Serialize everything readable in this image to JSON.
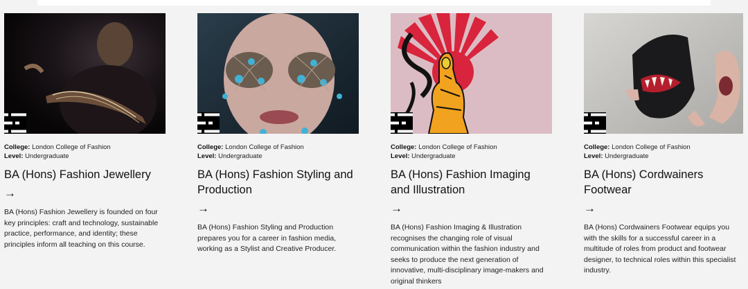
{
  "courses": [
    {
      "college_label": "College:",
      "college": "London College of Fashion",
      "level_label": "Level:",
      "level": "Undergraduate",
      "title": "BA (Hons) Fashion Jewellery",
      "arrow": "→",
      "description": "BA (Hons) Fashion Jewellery is founded on four key principles: craft and technology, sustainable practice, performance, and identity; these principles inform all teaching on this course.",
      "badge_icon": "course-list-icon"
    },
    {
      "college_label": "College:",
      "college": "London College of Fashion",
      "level_label": "Level:",
      "level": "Undergraduate",
      "title": "BA (Hons) Fashion Styling and Production",
      "arrow": "→",
      "description": "BA (Hons) Fashion Styling and Production prepares you for a career in fashion media, working as a Stylist and Creative Producer.",
      "badge_icon": "course-list-icon"
    },
    {
      "college_label": "College:",
      "college": "London College of Fashion",
      "level_label": "Level:",
      "level": "Undergraduate",
      "title": "BA (Hons) Fashion Imaging and Illustration",
      "arrow": "→",
      "description": "BA (Hons) Fashion Imaging & Illustration recognises the changing role of visual communication within the fashion industry and seeks to produce the next generation of innovative, multi-disciplinary image-makers and original thinkers",
      "badge_icon": "course-list-icon"
    },
    {
      "college_label": "College:",
      "college": "London College of Fashion",
      "level_label": "Level:",
      "level": "Undergraduate",
      "title": "BA (Hons) Cordwainers Footwear",
      "arrow": "→",
      "description": "BA (Hons) Cordwainers Footwear equips you with the skills for a successful career in a multitude of roles from product and footwear designer, to technical roles within this specialist industry.",
      "badge_icon": "course-list-icon"
    }
  ]
}
